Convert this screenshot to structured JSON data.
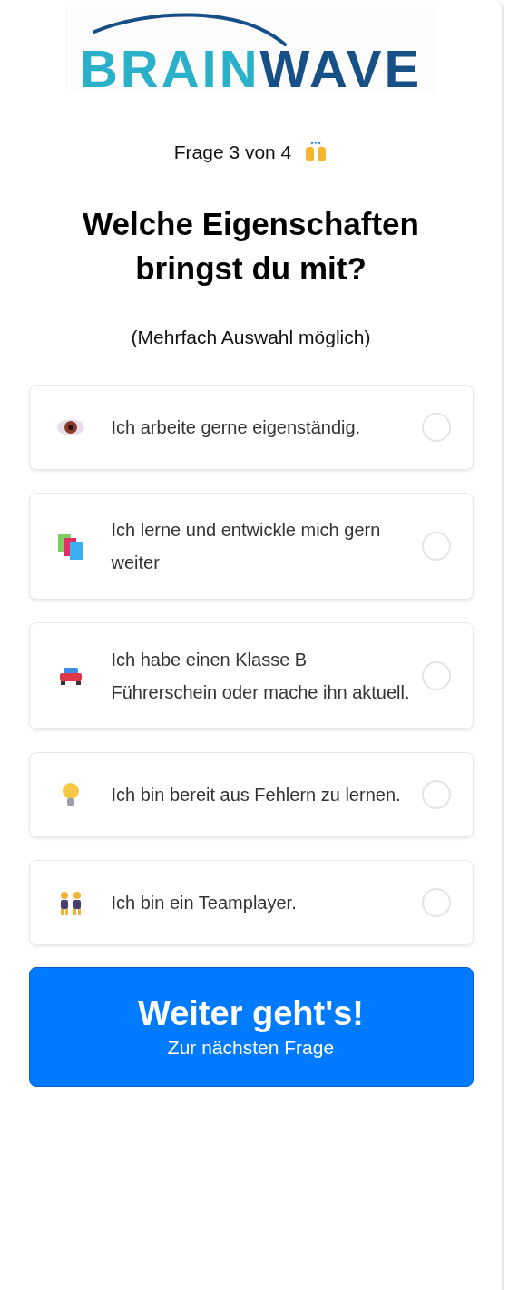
{
  "logo": {
    "first": "BRAIN",
    "second": "WAVE"
  },
  "progress": {
    "text": "Frage 3 von 4"
  },
  "question": {
    "title": "Welche Eigenschaften bringst du mit?",
    "hint": "(Mehrfach Auswahl möglich)"
  },
  "options": [
    {
      "kind": "eye",
      "label": "Ich arbeite gerne eigenständig.",
      "checked": false
    },
    {
      "kind": "books",
      "label": "Ich lerne und entwickle mich gern weiter",
      "checked": false
    },
    {
      "kind": "car",
      "label": "Ich habe einen Klasse B Führerschein oder mache ihn aktuell.",
      "checked": false
    },
    {
      "kind": "bulb",
      "label": "Ich bin bereit aus Fehlern zu lernen.",
      "checked": false
    },
    {
      "kind": "pair",
      "label": "Ich bin ein Teamplayer.",
      "checked": false
    }
  ],
  "next_button": {
    "title": "Weiter geht's!",
    "subtitle": "Zur nächsten Frage"
  }
}
